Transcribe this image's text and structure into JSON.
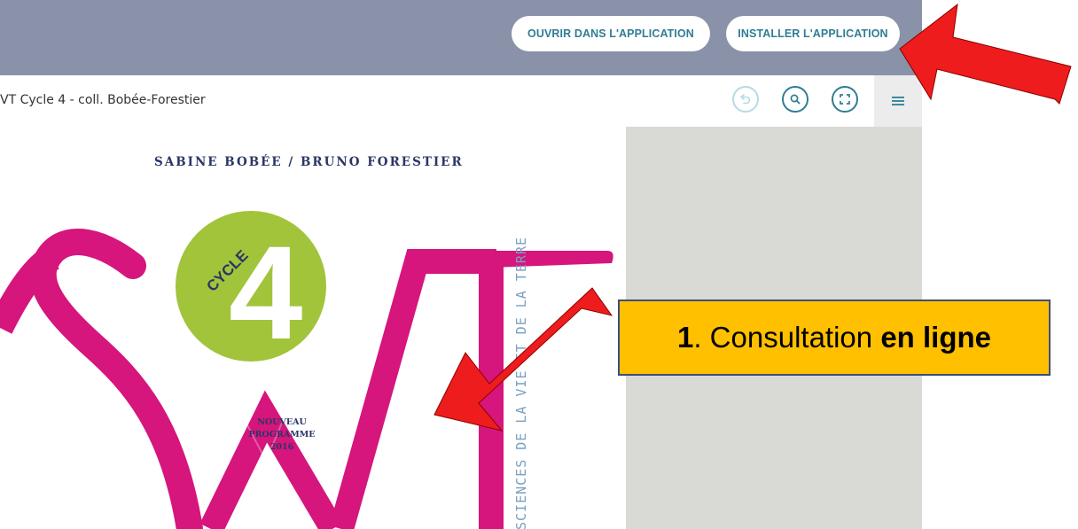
{
  "topbar": {
    "open_in_app_label": "OUVRIR DANS L'APPLICATION",
    "install_app_label": "INSTALLER L'APPLICATION"
  },
  "reader": {
    "book_title": "VT Cycle 4 - coll. Bobée-Forestier",
    "buttons": [
      "undo-icon",
      "search-icon",
      "fullscreen-icon",
      "menu-icon"
    ]
  },
  "cover": {
    "authors": "SABINE BOBÉE / BRUNO FORESTIER",
    "cycle_label": "CYCLE",
    "cycle_number": "4",
    "program_line1": "NOUVEAU",
    "program_line2": "PROGRAMME",
    "program_year": "2016",
    "vertical_title": "SCIENCES DE LA VIE ET DE LA TERRE"
  },
  "annotation": {
    "number": "1",
    "text": ". Consultation ",
    "bold": "en ligne"
  },
  "colors": {
    "banner": "#8992a8",
    "accent": "#2f7d96",
    "magenta": "#d6157d",
    "green": "#a1c43b",
    "arrow": "#ee1c1c",
    "callout": "#ffc000"
  }
}
